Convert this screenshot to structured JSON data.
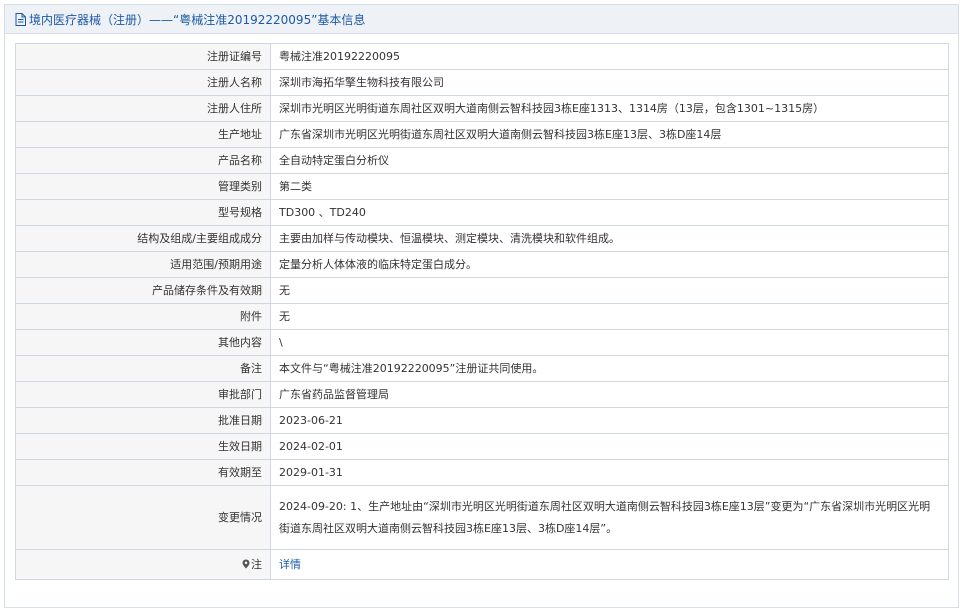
{
  "header": {
    "title_text": "境内医疗器械（注册）——“粤械注准20192220095”基本信息"
  },
  "rows": [
    {
      "label": "注册证编号",
      "value": "粤械注准20192220095"
    },
    {
      "label": "注册人名称",
      "value": "深圳市海拓华擎生物科技有限公司"
    },
    {
      "label": "注册人住所",
      "value": "深圳市光明区光明街道东周社区双明大道南侧云智科技园3栋E座1313、1314房（13层，包含1301~1315房）"
    },
    {
      "label": "生产地址",
      "value": "广东省深圳市光明区光明街道东周社区双明大道南侧云智科技园3栋E座13层、3栋D座14层"
    },
    {
      "label": "产品名称",
      "value": "全自动特定蛋白分析仪"
    },
    {
      "label": "管理类别",
      "value": "第二类"
    },
    {
      "label": "型号规格",
      "value": "TD300 、TD240"
    },
    {
      "label": "结构及组成/主要组成成分",
      "value": "主要由加样与传动模块、恒温模块、测定模块、清洗模块和软件组成。"
    },
    {
      "label": "适用范围/预期用途",
      "value": "定量分析人体体液的临床特定蛋白成分。"
    },
    {
      "label": "产品储存条件及有效期",
      "value": "无"
    },
    {
      "label": "附件",
      "value": "无"
    },
    {
      "label": "其他内容",
      "value": "\\"
    },
    {
      "label": "备注",
      "value": "本文件与“粤械注准20192220095”注册证共同使用。"
    },
    {
      "label": "审批部门",
      "value": "广东省药品监督管理局"
    },
    {
      "label": "批准日期",
      "value": "2023-06-21"
    },
    {
      "label": "生效日期",
      "value": "2024-02-01"
    },
    {
      "label": "有效期至",
      "value": "2029-01-31"
    }
  ],
  "change_row": {
    "label": "变更情况",
    "value": "2024-09-20: 1、生产地址由“深圳市光明区光明街道东周社区双明大道南侧云智科技园3栋E座13层”变更为“广东省深圳市光明区光明街道东周社区双明大道南侧云智科技园3栋E座13层、3栋D座14层”。"
  },
  "note_row": {
    "label": "注",
    "link_text": "详情"
  },
  "icons": {
    "header_icon": "document-icon",
    "note_icon": "map-pin-icon"
  },
  "colors": {
    "title_blue": "#1d5aa6",
    "header_bg": "#eef1f5",
    "label_bg": "#f6f6f6",
    "border": "#cfd8e1"
  }
}
